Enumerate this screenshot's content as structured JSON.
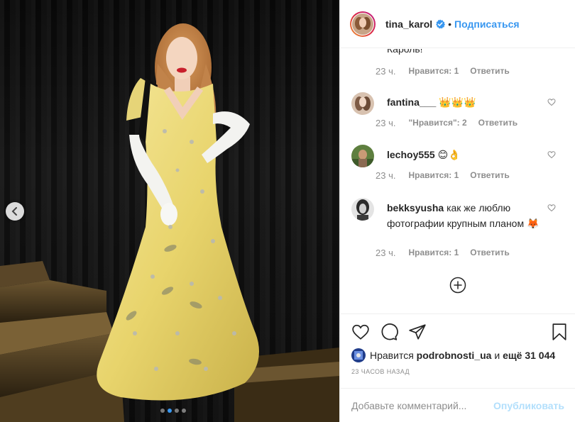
{
  "post": {
    "author": {
      "username": "tina_karol",
      "follow_label": "Подписаться",
      "separator": "•"
    },
    "image": {
      "carousel_dots": 4,
      "active_dot": 1
    },
    "partial_comment_text": "Кароль!",
    "comments": [
      {
        "partial": true,
        "time": "23 ч.",
        "likes": "Нравится: 1",
        "reply": "Ответить"
      },
      {
        "user": "fantina___",
        "text": "👑👑👑",
        "time": "23 ч.",
        "likes": "\"Нравится\": 2",
        "reply": "Ответить"
      },
      {
        "user": "lechoy555",
        "text": "😊👌",
        "time": "23 ч.",
        "likes": "Нравится: 1",
        "reply": "Ответить"
      },
      {
        "user": "bekksyusha",
        "text": "как же люблю фотографии крупным планом 🦊",
        "time": "23 ч.",
        "likes": "Нравится: 1",
        "reply": "Ответить"
      }
    ],
    "liked_by": {
      "prefix": "Нравится",
      "user": "podrobnosti_ua",
      "conj": "и",
      "rest": "ещё 31 044"
    },
    "timestamp": "23 часов назад",
    "composer": {
      "placeholder": "Добавьте комментарий...",
      "post_label": "Опубликовать"
    },
    "colors": {
      "accent": "#3897f0",
      "muted": "#8e8e8e",
      "dress": "#e9d77a"
    },
    "icons": [
      "verified-icon",
      "heart-icon",
      "comment-icon",
      "share-icon",
      "bookmark-icon",
      "plus-circle-icon",
      "chevron-left-icon"
    ]
  }
}
